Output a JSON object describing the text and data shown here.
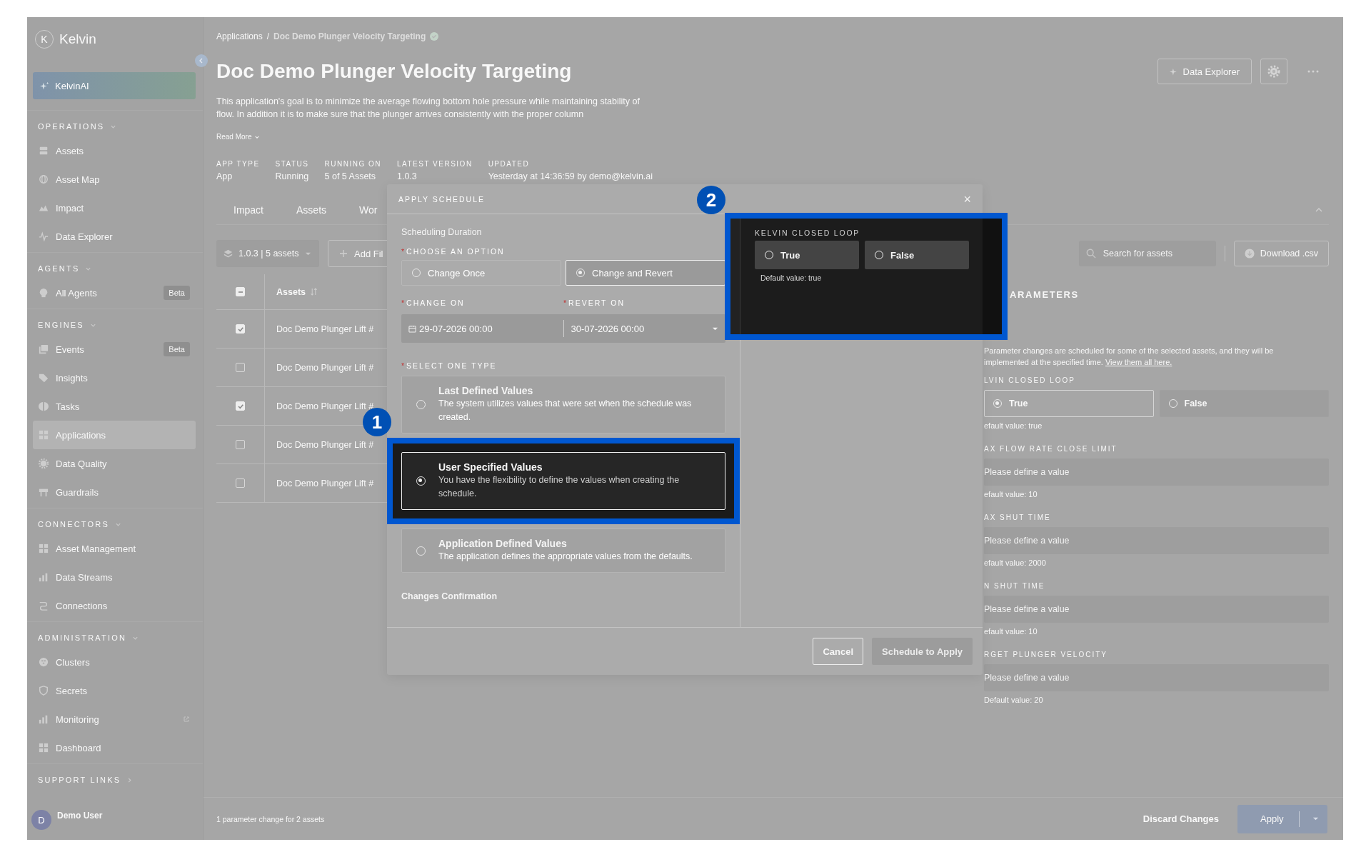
{
  "sidebar": {
    "logo_mark": "K",
    "logo_text": "Kelvin",
    "ai_button": "KelvinAI",
    "sections": [
      {
        "title": "OPERATIONS",
        "expanded": true,
        "items": [
          {
            "label": "Assets",
            "selected": false
          },
          {
            "label": "Asset Map",
            "selected": false
          },
          {
            "label": "Impact",
            "selected": false
          },
          {
            "label": "Data Explorer",
            "selected": false
          }
        ]
      },
      {
        "title": "AGENTS",
        "expanded": true,
        "items": [
          {
            "label": "All Agents",
            "selected": false,
            "badge": "Beta"
          }
        ]
      },
      {
        "title": "ENGINES",
        "expanded": true,
        "items": [
          {
            "label": "Events",
            "selected": false,
            "badge": "Beta"
          },
          {
            "label": "Insights",
            "selected": false
          },
          {
            "label": "Tasks",
            "selected": false
          },
          {
            "label": "Applications",
            "selected": true
          },
          {
            "label": "Data Quality",
            "selected": false
          },
          {
            "label": "Guardrails",
            "selected": false
          }
        ]
      },
      {
        "title": "CONNECTORS",
        "expanded": true,
        "items": [
          {
            "label": "Asset Management",
            "selected": false
          },
          {
            "label": "Data Streams",
            "selected": false
          },
          {
            "label": "Connections",
            "selected": false
          }
        ]
      },
      {
        "title": "ADMINISTRATION",
        "expanded": true,
        "items": [
          {
            "label": "Clusters",
            "selected": false
          },
          {
            "label": "Secrets",
            "selected": false
          },
          {
            "label": "Monitoring",
            "selected": false,
            "external": true
          },
          {
            "label": "Dashboard",
            "selected": false
          }
        ]
      }
    ],
    "support": {
      "title": "SUPPORT LINKS",
      "expanded": false
    },
    "user": {
      "initial": "D",
      "name": "Demo User"
    }
  },
  "breadcrumb": {
    "parent": "Applications",
    "separator": "/",
    "current": "Doc Demo Plunger Velocity Targeting"
  },
  "title": "Doc Demo Plunger Velocity Targeting",
  "description": "This application's goal is to minimize the average flowing bottom hole pressure while maintaining stability of flow. In addition it is to make sure that the plunger arrives consistently with the proper column",
  "read_more": "Read More",
  "header_button": "Data Explorer",
  "meta": [
    {
      "label": "APP TYPE",
      "value": "App"
    },
    {
      "label": "STATUS",
      "value": "Running"
    },
    {
      "label": "RUNNING ON",
      "value": "5 of 5 Assets"
    },
    {
      "label": "LATEST VERSION",
      "value": "1.0.3"
    },
    {
      "label": "UPDATED",
      "value": "Yesterday at 14:36:59 by demo@kelvin.ai"
    }
  ],
  "tabs": [
    {
      "label": "Impact"
    },
    {
      "label": "Assets"
    },
    {
      "label": "Wor"
    }
  ],
  "toolbar": {
    "version_select": "1.0.3 | 5 assets",
    "add_filter": "Add Fil",
    "search_placeholder": "Search for assets",
    "download": "Download .csv"
  },
  "table": {
    "column": "Assets",
    "header_indeterminate": true,
    "rows": [
      {
        "asset": "Doc Demo Plunger Lift #",
        "checked": true
      },
      {
        "asset": "Doc Demo Plunger Lift #",
        "checked": false
      },
      {
        "asset": "Doc Demo Plunger Lift #",
        "checked": true
      },
      {
        "asset": "Doc Demo Plunger Lift #",
        "checked": false
      },
      {
        "asset": "Doc Demo Plunger Lift #",
        "checked": false
      }
    ]
  },
  "parameters": {
    "title": "ARAMETERS",
    "notice": "Parameter changes are scheduled for some of the selected assets, and they will be implemented at the specified time.",
    "notice_link": "View them all here.",
    "fields": [
      {
        "kind": "radio",
        "label": "LVIN CLOSED LOOP",
        "options": [
          {
            "label": "True",
            "selected": true
          },
          {
            "label": "False",
            "selected": false
          }
        ],
        "hint": "efault value: true"
      },
      {
        "kind": "input",
        "label": "AX FLOW RATE CLOSE LIMIT",
        "placeholder": "Please define a value",
        "hint": "efault value: 10"
      },
      {
        "kind": "input",
        "label": "AX SHUT TIME",
        "placeholder": "Please define a value",
        "hint": "efault value: 2000"
      },
      {
        "kind": "input",
        "label": "N SHUT TIME",
        "placeholder": "Please define a value",
        "hint": "efault value: 10"
      },
      {
        "kind": "input",
        "label": "RGET PLUNGER VELOCITY",
        "placeholder": "Please define a value",
        "hint": "Default value: 20"
      }
    ]
  },
  "footer": {
    "summary": "1 parameter change for 2 assets",
    "discard": "Discard Changes",
    "apply": "Apply"
  },
  "modal": {
    "title": "APPLY SCHEDULE",
    "close": "×",
    "section": "Scheduling Duration",
    "option_label": {
      "mark": "*",
      "text": "CHOOSE AN OPTION"
    },
    "options": [
      {
        "label": "Change Once",
        "selected": false
      },
      {
        "label": "Change and Revert",
        "selected": true
      }
    ],
    "change_on_label": {
      "mark": "*",
      "text": "CHANGE ON"
    },
    "revert_on_label": {
      "mark": "*",
      "text": "REVERT ON"
    },
    "change_on": "29-07-2026 00:00",
    "revert_on": "30-07-2026 00:00",
    "type_label": {
      "mark": "*",
      "text": "SELECT ONE TYPE"
    },
    "types": [
      {
        "title": "Last Defined Values",
        "description": "The system utilizes values that were set when the schedule was created.",
        "selected": false
      },
      {
        "title": "User Specified Values",
        "description": "You have the flexibility to define the values when creating the schedule.",
        "selected": true,
        "annotation": "1"
      },
      {
        "title": "Application Defined Values",
        "description": "The application defines the appropriate values from the defaults.",
        "selected": false
      }
    ],
    "confirmation": "Changes Confirmation",
    "cancel": "Cancel",
    "submit": "Schedule to Apply",
    "submit_disabled": true,
    "callout": {
      "annotation": "2",
      "label": "KELVIN CLOSED LOOP",
      "options": [
        {
          "label": "True",
          "selected": false
        },
        {
          "label": "False",
          "selected": false
        }
      ],
      "hint": "Default value: true"
    }
  }
}
